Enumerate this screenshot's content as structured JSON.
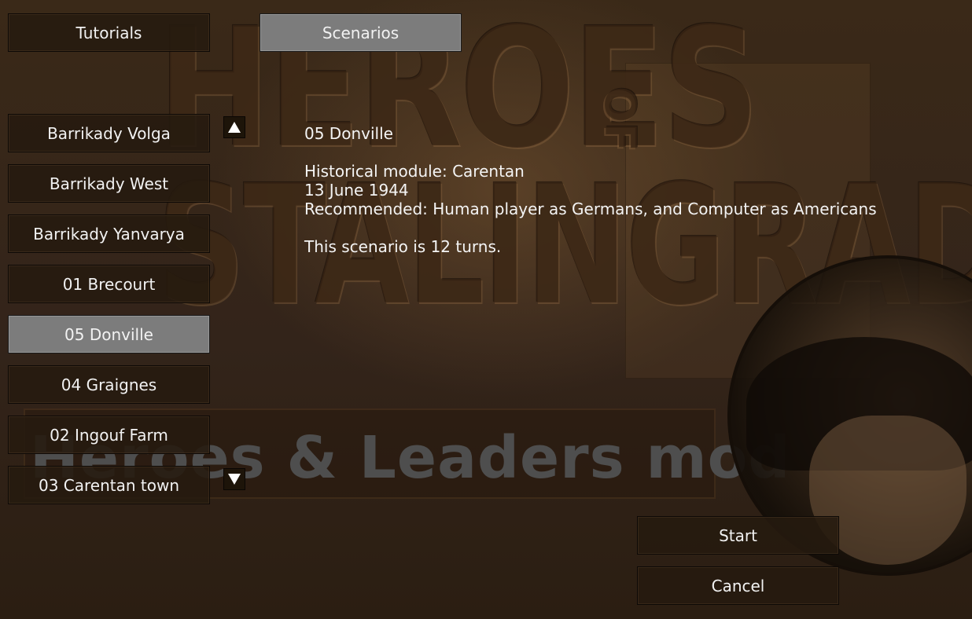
{
  "top_tabs": {
    "tutorials_label": "Tutorials",
    "scenarios_label": "Scenarios"
  },
  "background": {
    "title_top": "HEROES",
    "title_of": "OF",
    "title_bottom": "STALINGRAD",
    "mod_banner": "Heroes & Leaders mod"
  },
  "scenario_list": {
    "items": [
      {
        "label": "Barrikady Volga",
        "selected": false
      },
      {
        "label": "Barrikady West",
        "selected": false
      },
      {
        "label": "Barrikady Yanvarya",
        "selected": false
      },
      {
        "label": "01 Brecourt",
        "selected": false
      },
      {
        "label": "05 Donville",
        "selected": true
      },
      {
        "label": "04 Graignes",
        "selected": false
      },
      {
        "label": "02 Ingouf Farm",
        "selected": false
      },
      {
        "label": "03 Carentan town",
        "selected": false
      }
    ],
    "scroll_up_icon": "triangle-up-icon",
    "scroll_down_icon": "triangle-down-icon"
  },
  "details": {
    "name": "05 Donville",
    "module": "Historical module: Carentan",
    "date": "13 June 1944",
    "recommended": "Recommended: Human player as Germans, and Computer as Americans",
    "turns": "This scenario is 12 turns."
  },
  "actions": {
    "start_label": "Start",
    "cancel_label": "Cancel"
  },
  "colors": {
    "background": "#33241a",
    "button_bg": "#261a0f",
    "selected_bg": "#7c7c7c",
    "text": "#f2f2f2",
    "mod_text": "#4e4e4e"
  }
}
